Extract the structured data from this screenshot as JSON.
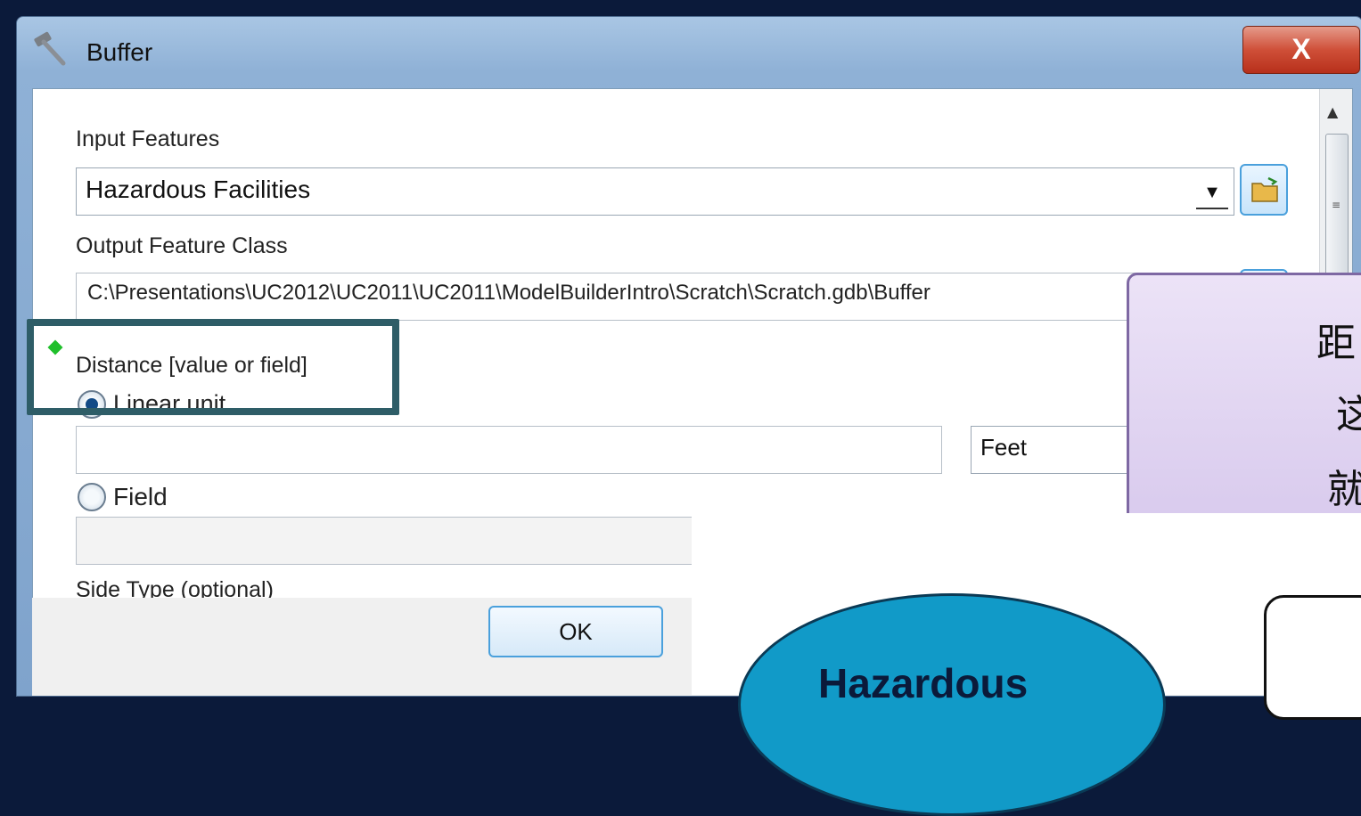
{
  "window": {
    "title": "Buffer",
    "close_label": "X"
  },
  "form": {
    "input_features_label": "Input Features",
    "input_features_value": "Hazardous Facilities",
    "output_feature_class_label": "Output Feature Class",
    "output_feature_class_value": "C:\\Presentations\\UC2012\\UC2011\\UC2011\\ModelBuilderIntro\\Scratch\\Scratch.gdb\\Buffer",
    "distance_label": "Distance [value or field]",
    "linear_unit_label": "Linear unit",
    "linear_unit_value": "",
    "unit_value": "Feet",
    "field_label": "Field",
    "field_value": "",
    "side_type_label": "Side Type (optional)"
  },
  "footer": {
    "ok_label": "OK"
  },
  "overlay": {
    "callout_lines": [
      "距",
      "这",
      "就"
    ],
    "ellipse_label": "Hazardous"
  },
  "colors": {
    "highlight_border": "#2e5d67",
    "required_indicator": "#1fbf2b",
    "callout_bg": "#d6c7ec",
    "ellipse_fill": "#119ac8"
  }
}
